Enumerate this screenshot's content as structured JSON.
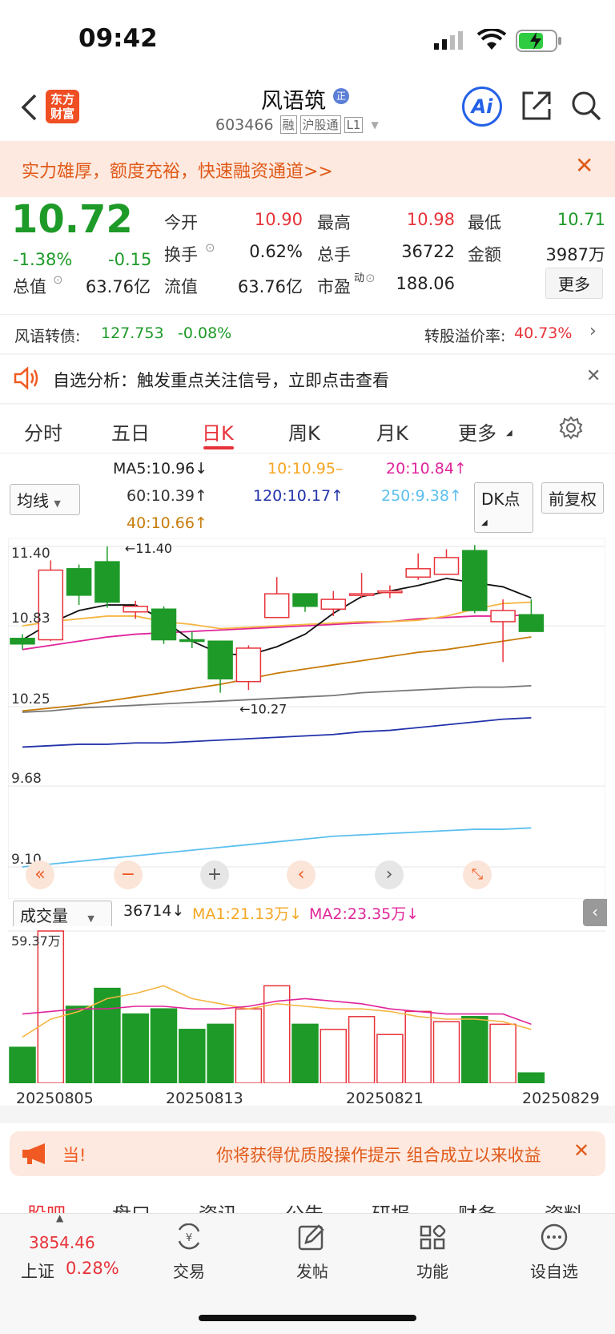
{
  "status": {
    "time": "09:42"
  },
  "nav": {
    "stock_name": "风语筑",
    "logo_line1": "东方",
    "logo_line2": "财富",
    "code": "603466",
    "tag1": "融",
    "tag2": "沪股通",
    "tag3": "L1",
    "ai_label": "Ai",
    "name_badge": "正"
  },
  "banner": {
    "text": "实力雄厚，额度充裕，快速融资通道>>"
  },
  "quote": {
    "price": "10.72",
    "change_pct": "-1.38%",
    "change": "-0.15",
    "open_label": "今开",
    "open": "10.90",
    "high_label": "最高",
    "high": "10.98",
    "low_label": "最低",
    "low": "10.71",
    "turnover_label": "换手",
    "turnover": "0.62%",
    "volume_label": "总手",
    "volume": "36722",
    "amount_label": "金额",
    "amount": "3987万",
    "mktcap_label": "总值",
    "mktcap": "63.76亿",
    "float_label": "流值",
    "float_cap": "63.76亿",
    "pe_label": "市盈",
    "pe_sup": "动",
    "pe": "188.06",
    "more_button": "更多"
  },
  "bond": {
    "label": "风语转债:",
    "price": "127.753",
    "change": "-0.08%",
    "premium_label": "转股溢价率:",
    "premium": "40.73%"
  },
  "notice": {
    "text": "自选分析：触发重点关注信号，立即点击查看"
  },
  "tabs": [
    "分时",
    "五日",
    "日K",
    "周K",
    "月K",
    "更多"
  ],
  "active_tab": 2,
  "ma": {
    "ma5": "MA5:10.96",
    "ma10": "10:10.95",
    "ma20": "20:10.84",
    "ma60": "60:10.39",
    "ma120": "120:10.17",
    "ma250": "250:9.38",
    "ma40": "40:10.66",
    "selector": "均线",
    "dk_button": "DK点",
    "adjust_button": "前复权"
  },
  "chart_data": {
    "type": "candlestick",
    "y_ticks": [
      "11.40",
      "10.83",
      "10.25",
      "9.68",
      "9.10"
    ],
    "annotations": {
      "high": "11.40",
      "low": "10.27"
    },
    "dates": [
      "20250805",
      "20250813",
      "20250821",
      "20250829"
    ],
    "candles": [
      {
        "o": 10.74,
        "c": 10.7,
        "h": 10.77,
        "l": 10.66,
        "up": false
      },
      {
        "o": 10.73,
        "c": 11.23,
        "h": 11.3,
        "l": 10.72,
        "up": true
      },
      {
        "o": 11.24,
        "c": 11.05,
        "h": 11.27,
        "l": 10.98,
        "up": false
      },
      {
        "o": 11.29,
        "c": 11.0,
        "h": 11.4,
        "l": 10.96,
        "up": false
      },
      {
        "o": 10.93,
        "c": 10.97,
        "h": 11.01,
        "l": 10.88,
        "up": true
      },
      {
        "o": 10.95,
        "c": 10.73,
        "h": 10.97,
        "l": 10.7,
        "up": false
      },
      {
        "o": 10.73,
        "c": 10.72,
        "h": 10.79,
        "l": 10.67,
        "up": false
      },
      {
        "o": 10.72,
        "c": 10.45,
        "h": 10.72,
        "l": 10.35,
        "up": false
      },
      {
        "o": 10.43,
        "c": 10.67,
        "h": 10.69,
        "l": 10.37,
        "up": true
      },
      {
        "o": 10.89,
        "c": 11.06,
        "h": 11.18,
        "l": 10.89,
        "up": true
      },
      {
        "o": 11.06,
        "c": 10.97,
        "h": 11.06,
        "l": 10.93,
        "up": false
      },
      {
        "o": 10.95,
        "c": 11.02,
        "h": 11.08,
        "l": 10.9,
        "up": true
      },
      {
        "o": 11.06,
        "c": 11.06,
        "h": 11.21,
        "l": 11.03,
        "up": true
      },
      {
        "o": 11.08,
        "c": 11.08,
        "h": 11.12,
        "l": 11.03,
        "up": true
      },
      {
        "o": 11.18,
        "c": 11.24,
        "h": 11.35,
        "l": 11.16,
        "up": true
      },
      {
        "o": 11.2,
        "c": 11.32,
        "h": 11.38,
        "l": 11.2,
        "up": true
      },
      {
        "o": 11.37,
        "c": 10.94,
        "h": 11.41,
        "l": 10.92,
        "up": false
      },
      {
        "o": 10.86,
        "c": 10.94,
        "h": 11.02,
        "l": 10.57,
        "up": true
      },
      {
        "o": 10.91,
        "c": 10.79,
        "h": 11.02,
        "l": 10.79,
        "up": false
      }
    ],
    "ma5_line": [
      10.73,
      10.85,
      10.94,
      10.98,
      10.98,
      10.87,
      10.72,
      10.63,
      10.62,
      10.68,
      10.77,
      10.92,
      11.04,
      11.08,
      11.12,
      11.17,
      11.14,
      11.11,
      11.03
    ],
    "ma10_line": [
      10.83,
      10.86,
      10.88,
      10.9,
      10.9,
      10.86,
      10.84,
      10.81,
      10.82,
      10.83,
      10.84,
      10.85,
      10.86,
      10.86,
      10.87,
      10.9,
      10.95,
      10.99,
      11.0
    ],
    "ma20_line": [
      10.66,
      10.69,
      10.72,
      10.75,
      10.77,
      10.78,
      10.79,
      10.8,
      10.81,
      10.82,
      10.83,
      10.84,
      10.85,
      10.86,
      10.88,
      10.89,
      10.9,
      10.9,
      10.91
    ],
    "ma40_line": [
      10.22,
      10.24,
      10.26,
      10.29,
      10.32,
      10.35,
      10.38,
      10.41,
      10.45,
      10.49,
      10.52,
      10.55,
      10.58,
      10.61,
      10.64,
      10.66,
      10.69,
      10.72,
      10.75
    ],
    "ma60_line": [
      10.21,
      10.22,
      10.24,
      10.25,
      10.26,
      10.27,
      10.28,
      10.29,
      10.3,
      10.31,
      10.32,
      10.33,
      10.35,
      10.36,
      10.37,
      10.38,
      10.39,
      10.39,
      10.4
    ],
    "ma120_line": [
      9.96,
      9.97,
      9.98,
      9.98,
      9.99,
      9.99,
      10.0,
      10.01,
      10.02,
      10.03,
      10.04,
      10.05,
      10.07,
      10.08,
      10.1,
      10.12,
      10.14,
      10.16,
      10.17
    ],
    "ma250_line": [
      9.1,
      9.12,
      9.14,
      9.16,
      9.18,
      9.2,
      9.22,
      9.24,
      9.26,
      9.28,
      9.3,
      9.32,
      9.33,
      9.34,
      9.35,
      9.36,
      9.37,
      9.37,
      9.38
    ],
    "y_range": [
      9.1,
      11.4
    ],
    "volume": {
      "label": "成交量",
      "current": "36714",
      "ma1": "MA1:21.13万",
      "ma2": "MA2:23.35万",
      "max_label": "59.37万",
      "bars": [
        14,
        59.37,
        30,
        37,
        27,
        29,
        21,
        23,
        29,
        38,
        23,
        21,
        26,
        19,
        28,
        24,
        26,
        23,
        4
      ],
      "up": [
        false,
        true,
        false,
        false,
        false,
        false,
        false,
        false,
        true,
        true,
        false,
        true,
        true,
        true,
        true,
        true,
        false,
        true,
        false
      ],
      "ma1_line": [
        18,
        25,
        28,
        33,
        35,
        38,
        33,
        31,
        29,
        31,
        30,
        29,
        29,
        28,
        26,
        25,
        25,
        24,
        21
      ],
      "ma2_line": [
        27,
        28,
        29,
        29,
        30,
        30,
        29,
        29,
        30,
        32,
        33,
        32,
        31,
        29,
        28,
        27,
        27,
        27,
        23
      ]
    }
  },
  "promo": {
    "tag": "当!",
    "text": "你将获得优质股操作提示 组合成立以来收益"
  },
  "subtabs": [
    "股吧",
    "盘口",
    "资讯",
    "公告",
    "研报",
    "财务",
    "资料"
  ],
  "bottom": {
    "index_value": "3854.46",
    "index_name": "上证",
    "index_change": "0.28%",
    "trade": "交易",
    "post": "发帖",
    "func": "功能",
    "watch": "设自选"
  }
}
